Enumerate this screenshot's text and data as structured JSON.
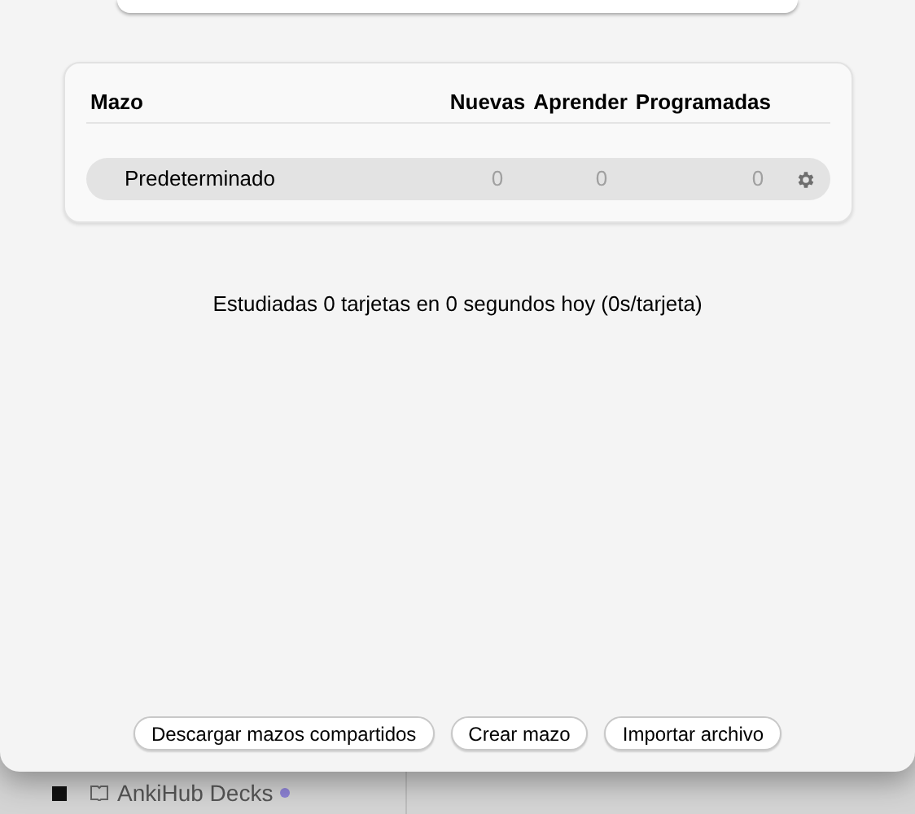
{
  "deck_table": {
    "columns": [
      "Mazo",
      "Nuevas",
      "Aprender",
      "Programadas"
    ],
    "rows": [
      {
        "name": "Predeterminado",
        "new": "0",
        "learn": "0",
        "due": "0",
        "selected": true
      }
    ]
  },
  "stats": "Estudiadas 0 tarjetas en 0 segundos hoy (0s/tarjeta)",
  "buttons": [
    "Descargar mazos compartidos",
    "Crear mazo",
    "Importar archivo"
  ],
  "background_sidebar": {
    "items": [
      {
        "label": "AnkiHub Decks",
        "color": "#8e83d6"
      }
    ]
  }
}
